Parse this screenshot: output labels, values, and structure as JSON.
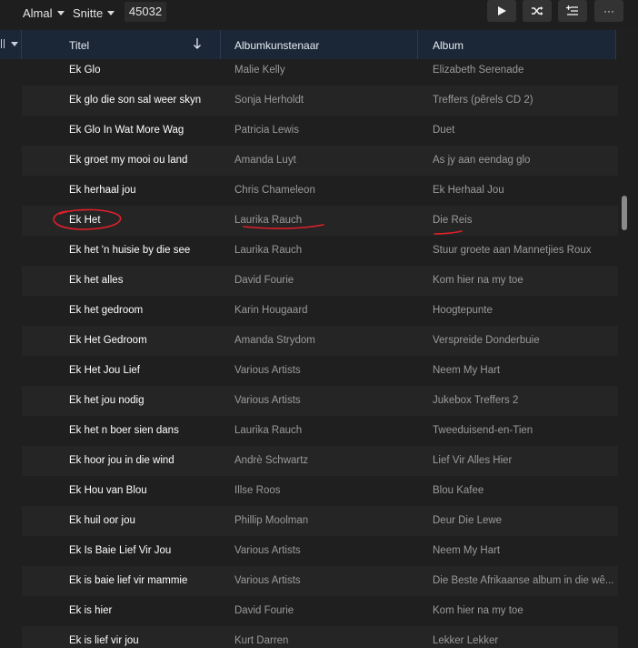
{
  "toolbar": {
    "filter1": "Almal",
    "filter2": "Snitte",
    "count": "45032",
    "play_icon": "play-icon",
    "shuffle_icon": "shuffle-icon",
    "add_to_queue_icon": "add-to-queue-icon",
    "more_label": "···"
  },
  "header": {
    "title": "Titel",
    "album_artist": "Albumkunstenaar",
    "album": "Album",
    "sort_icon": "sort-down-arrow-icon"
  },
  "rows": [
    {
      "title": "Ek Glo",
      "artist": "Malie Kelly",
      "album": "Elizabeth Serenade"
    },
    {
      "title": "Ek glo die son sal weer skyn",
      "artist": "Sonja Herholdt",
      "album": "Treffers (pêrels CD 2)"
    },
    {
      "title": "Ek Glo In Wat More Wag",
      "artist": "Patricia Lewis",
      "album": "Duet"
    },
    {
      "title": "Ek groet my mooi ou land",
      "artist": "Amanda Luyt",
      "album": "As jy aan eendag glo"
    },
    {
      "title": "Ek herhaal jou",
      "artist": "Chris Chameleon",
      "album": "Ek Herhaal Jou"
    },
    {
      "title": "Ek Het",
      "artist": "Laurika Rauch",
      "album": "Die Reis"
    },
    {
      "title": "Ek het 'n huisie by die see",
      "artist": "Laurika Rauch",
      "album": "Stuur groete aan Mannetjies Roux"
    },
    {
      "title": "Ek het alles",
      "artist": "David Fourie",
      "album": "Kom hier na my toe"
    },
    {
      "title": "Ek het gedroom",
      "artist": "Karin Hougaard",
      "album": "Hoogtepunte"
    },
    {
      "title": "Ek Het Gedroom",
      "artist": "Amanda Strydom",
      "album": "Verspreide Donderbuie"
    },
    {
      "title": "Ek Het Jou Lief",
      "artist": "Various Artists",
      "album": "Neem My Hart"
    },
    {
      "title": "Ek het jou nodig",
      "artist": "Various Artists",
      "album": "Jukebox Treffers 2"
    },
    {
      "title": "Ek het n boer sien dans",
      "artist": "Laurika Rauch",
      "album": "Tweeduisend-en-Tien"
    },
    {
      "title": "Ek hoor jou in die wind",
      "artist": "Andrè Schwartz",
      "album": "Lief Vir Alles Hier"
    },
    {
      "title": "Ek Hou van Blou",
      "artist": "Illse Roos",
      "album": "Blou Kafee"
    },
    {
      "title": "Ek huil oor jou",
      "artist": "Phillip Moolman",
      "album": "Deur Die Lewe"
    },
    {
      "title": "Ek Is Baie Lief Vir Jou",
      "artist": "Various Artists",
      "album": "Neem My Hart"
    },
    {
      "title": "Ek is baie lief vir mammie",
      "artist": "Various Artists",
      "album": "Die Beste Afrikaanse album in die wê..."
    },
    {
      "title": "Ek is hier",
      "artist": "David Fourie",
      "album": "Kom hier na my toe"
    },
    {
      "title": "Ek is lief vir jou",
      "artist": "Kurt Darren",
      "album": "Lekker Lekker"
    }
  ],
  "colors": {
    "background": "#1f1f1f",
    "header": "#1b2737",
    "annotation": "#e0202a"
  }
}
